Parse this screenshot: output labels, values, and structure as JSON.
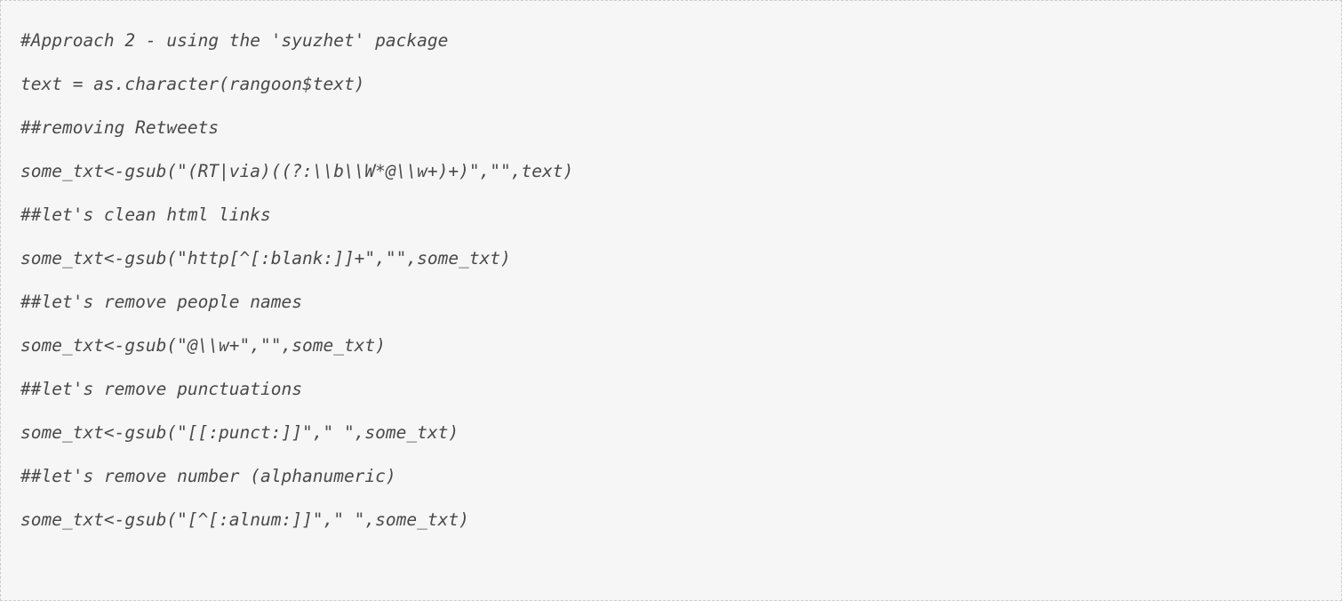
{
  "code": {
    "lines": [
      "#Approach 2 - using the 'syuzhet' package",
      "text = as.character(rangoon$text)",
      "##removing Retweets",
      "some_txt<-gsub(\"(RT|via)((?:\\\\b\\\\W*@\\\\w+)+)\",\"\",text)",
      "##let's clean html links",
      "some_txt<-gsub(\"http[^[:blank:]]+\",\"\",some_txt)",
      "##let's remove people names",
      "some_txt<-gsub(\"@\\\\w+\",\"\",some_txt)",
      "##let's remove punctuations",
      "some_txt<-gsub(\"[[:punct:]]\",\" \",some_txt)",
      "##let's remove number (alphanumeric)",
      "some_txt<-gsub(\"[^[:alnum:]]\",\" \",some_txt)"
    ]
  }
}
